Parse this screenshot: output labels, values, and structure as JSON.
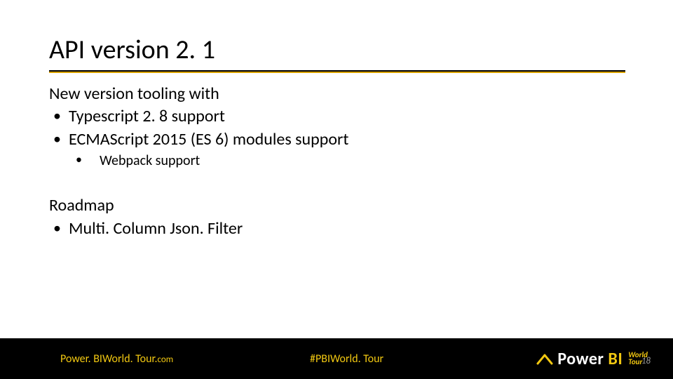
{
  "title": "API version 2. 1",
  "section1": {
    "heading": "New version tooling with",
    "items": [
      "Typescript 2. 8 support",
      "ECMAScript 2015 (ES 6) modules support"
    ],
    "subitems": [
      "Webpack support"
    ]
  },
  "section2": {
    "heading": "Roadmap",
    "items": [
      "Multi. Column Json. Filter"
    ]
  },
  "footer": {
    "left_main": "Power. BIWorld. Tour.",
    "left_domain": "com",
    "hashtag": "#PBIWorld. Tour",
    "brand_prefix": "Power ",
    "brand_bi": "BI",
    "brand_sub1": "World",
    "brand_sub2": "Tour"
  },
  "page_number": "18",
  "colors": {
    "accent": "#f2c811",
    "gold_line": "#d9a300",
    "footer_bg": "#000000"
  }
}
